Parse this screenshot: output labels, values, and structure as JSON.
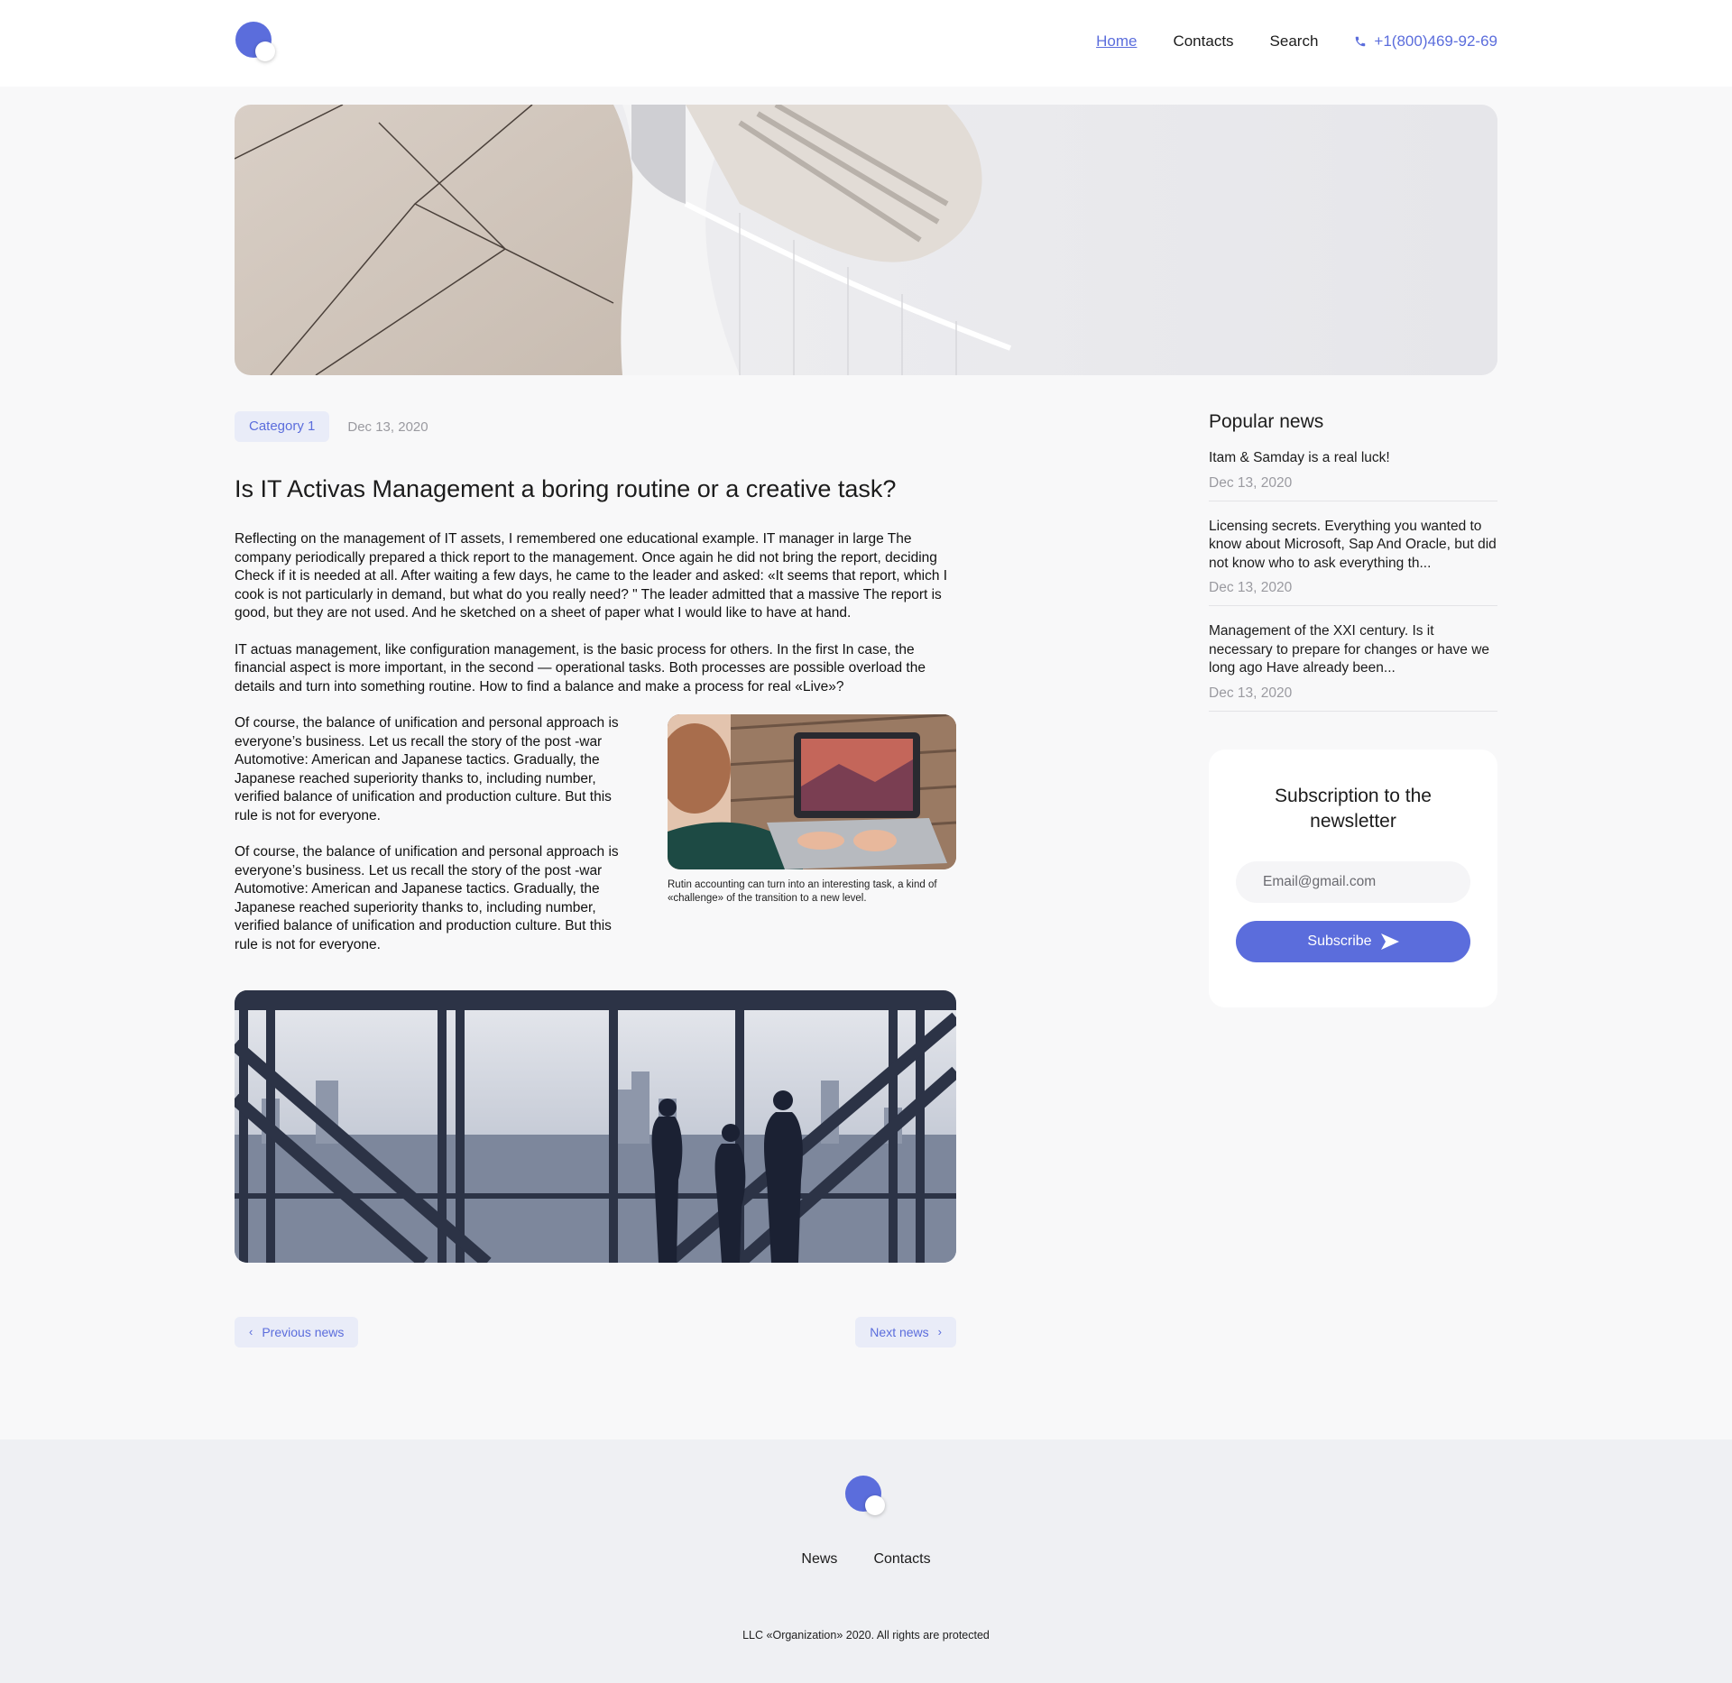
{
  "header": {
    "nav": [
      {
        "label": "Home",
        "active": true
      },
      {
        "label": "Contacts",
        "active": false
      },
      {
        "label": "Search",
        "active": false
      }
    ],
    "phone": "+1(800)469-92-69",
    "accent_color": "#5b6ddc"
  },
  "article": {
    "category": "Category 1",
    "date": "Dec 13, 2020",
    "title": "Is IT Activas Management a boring routine or a creative task?",
    "paragraphs": [
      "Reflecting on the management of IT assets, I remembered one educational example. IT manager in large The company periodically prepared a thick report to the management. Once again he did not bring the report, deciding Check if it is needed at all. After waiting a few days, he came to the leader and asked: «It seems that report, which I cook is not particularly in demand, but what do you really need? \" The leader admitted that a massive The report is good, but they are not used. And he sketched on a sheet of paper what I would like to have at hand.",
      "IT actuas management, like configuration management, is the basic process for others. In the first In case, the financial aspect is more important, in the second — operational tasks. Both processes are possible overload the details and turn into something routine. How to find a balance and make a process for real «Live»?",
      "Of course, the balance of unification and personal approach is everyone’s business. Let us recall the story of the post -war Automotive: American and Japanese tactics. Gradually, the Japanese reached superiority thanks to, including number, verified balance of unification and production culture. But this rule is not for everyone.",
      "Of course, the balance of unification and personal approach is everyone’s business. Let us recall the story of the post -war Automotive: American and Japanese tactics. Gradually, the Japanese reached superiority thanks to, including number, verified balance of unification and production culture. But this rule is not for everyone."
    ],
    "figure_caption": "Rutin accounting can turn into an interesting task, a kind of «challenge» of the transition to a new level.",
    "prev_label": "Previous news",
    "next_label": "Next news"
  },
  "sidebar": {
    "popular_title": "Popular news",
    "popular": [
      {
        "title": "Itam & Samday is a real luck!",
        "date": "Dec 13, 2020"
      },
      {
        "title": "Licensing secrets. Everything you wanted to know about Microsoft, Sap And Oracle, but did not know who to ask everything th...",
        "date": "Dec 13, 2020"
      },
      {
        "title": "Management of the XXI century. Is it necessary to prepare for changes or have we long ago Have already been...",
        "date": "Dec 13, 2020"
      }
    ],
    "newsletter": {
      "title": "Subscription to the newsletter",
      "email_placeholder": "Email@gmail.com",
      "button_label": "Subscribe"
    }
  },
  "footer": {
    "nav": [
      "News",
      "Contacts"
    ],
    "copyright": "LLC «Organization» 2020. All rights are protected"
  }
}
